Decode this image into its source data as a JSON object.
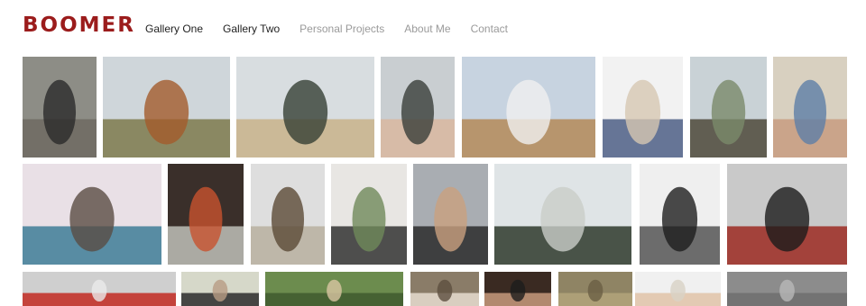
{
  "site": {
    "logo": "BOOMER"
  },
  "nav": [
    {
      "id": "gallery-one",
      "label": "Gallery One",
      "active": true
    },
    {
      "id": "gallery-two",
      "label": "Gallery Two",
      "active": true
    },
    {
      "id": "personal-projects",
      "label": "Personal Projects",
      "active": false
    },
    {
      "id": "about-me",
      "label": "About Me",
      "active": false
    },
    {
      "id": "contact",
      "label": "Contact",
      "active": false
    }
  ],
  "colors": {
    "logo": "#9b1c1c",
    "nav_active": "#222222",
    "nav_inactive": "#9a9a9a"
  },
  "gallery": {
    "rows": [
      [
        {
          "subject": "man-standing-by-building"
        },
        {
          "subject": "field-with-trucks"
        },
        {
          "subject": "cabin-in-snow"
        },
        {
          "subject": "older-man-portrait"
        },
        {
          "subject": "frozen-marsh-trees"
        },
        {
          "subject": "two-cowboys"
        },
        {
          "subject": "forest-with-ribbons"
        },
        {
          "subject": "elderly-man-plaid-shirt"
        }
      ],
      [
        {
          "subject": "diner-interior"
        },
        {
          "subject": "candle-closeup"
        },
        {
          "subject": "camper-van"
        },
        {
          "subject": "wall-with-lamp"
        },
        {
          "subject": "woman-arms-crossed"
        },
        {
          "subject": "trailer-in-snow"
        },
        {
          "subject": "cowboy-black-white"
        },
        {
          "subject": "man-on-motorcycle"
        }
      ],
      [
        {
          "subject": "red-airplane"
        },
        {
          "subject": "cowboy-hats"
        },
        {
          "subject": "forest-person"
        },
        {
          "subject": "skulls-on-wall"
        },
        {
          "subject": "cowboy-portrait"
        },
        {
          "subject": "dry-ground"
        },
        {
          "subject": "smiling-cowboy"
        },
        {
          "subject": "abstract-light"
        }
      ]
    ]
  }
}
